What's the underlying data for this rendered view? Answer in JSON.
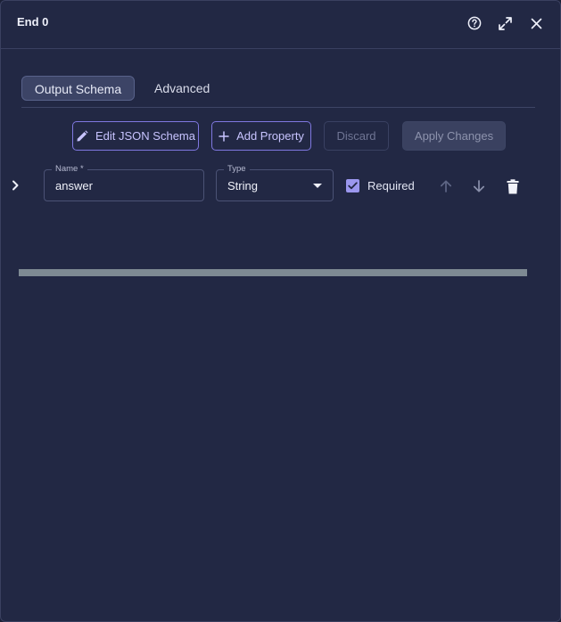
{
  "header": {
    "title": "End 0",
    "help_icon": "help-circle-icon",
    "expand_icon": "expand-icon",
    "close_icon": "close-icon"
  },
  "tabs": [
    {
      "label": "Output Schema",
      "active": true
    },
    {
      "label": "Advanced",
      "active": false
    }
  ],
  "toolbar": {
    "edit_json_label": "Edit JSON Schema",
    "edit_json_icon": "pencil-icon",
    "add_property_label": "Add Property",
    "add_property_icon": "plus-icon",
    "discard_label": "Discard",
    "apply_label": "Apply Changes"
  },
  "property": {
    "name_label": "Name *",
    "name_value": "answer",
    "type_label": "Type",
    "type_value": "String",
    "required_label": "Required",
    "required_checked": true
  },
  "colors": {
    "panel_bg": "#222844",
    "accent": "#7f78e0",
    "checkbox": "#9b97ee"
  }
}
